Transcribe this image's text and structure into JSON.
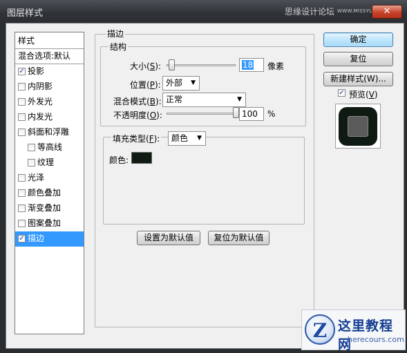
{
  "window": {
    "title": "图层样式",
    "watermark": "思缘设计论坛",
    "watermark_url": "WWW.MISSYUAN.COM",
    "close_glyph": "✕"
  },
  "styles_list": {
    "header": "样式",
    "blend_options": "混合选项:默认",
    "items": [
      {
        "label": "投影",
        "checked": true,
        "indent": false
      },
      {
        "label": "内阴影",
        "checked": false,
        "indent": false
      },
      {
        "label": "外发光",
        "checked": false,
        "indent": false
      },
      {
        "label": "内发光",
        "checked": false,
        "indent": false
      },
      {
        "label": "斜面和浮雕",
        "checked": false,
        "indent": false
      },
      {
        "label": "等高线",
        "checked": false,
        "indent": true
      },
      {
        "label": "纹理",
        "checked": false,
        "indent": true
      },
      {
        "label": "光泽",
        "checked": false,
        "indent": false
      },
      {
        "label": "颜色叠加",
        "checked": false,
        "indent": false
      },
      {
        "label": "渐变叠加",
        "checked": false,
        "indent": false
      },
      {
        "label": "图案叠加",
        "checked": false,
        "indent": false
      },
      {
        "label": "描边",
        "checked": true,
        "indent": false,
        "selected": true
      }
    ]
  },
  "stroke": {
    "group_title": "描边",
    "structure_title": "结构",
    "size_label": "大小",
    "size_key": "S",
    "size_value": "18",
    "size_unit": "像素",
    "size_fraction": 0.07,
    "position_label": "位置",
    "position_key": "P",
    "position_value": "外部",
    "blend_label": "混合模式",
    "blend_key": "B",
    "blend_value": "正常",
    "opacity_label": "不透明度",
    "opacity_key": "O",
    "opacity_value": "100",
    "opacity_unit": "%",
    "opacity_fraction": 1.0,
    "fill_type_label": "填充类型",
    "fill_type_key": "F",
    "fill_type_value": "颜色",
    "color_label": "颜色:",
    "color": "#0f1a12",
    "make_default": "设置为默认值",
    "reset_default": "复位为默认值"
  },
  "buttons": {
    "ok": "确定",
    "reset": "复位",
    "new_style": "新建样式(W)...",
    "preview_label": "预览",
    "preview_key": "V",
    "preview_checked": true
  },
  "logo": {
    "name": "这里教程网",
    "url": "herecours.com",
    "mark": "Z"
  },
  "accent": "#3399ff",
  "close_color": "#c8442b",
  "check_glyph": "✓",
  "dropdown_glyph": "▼"
}
